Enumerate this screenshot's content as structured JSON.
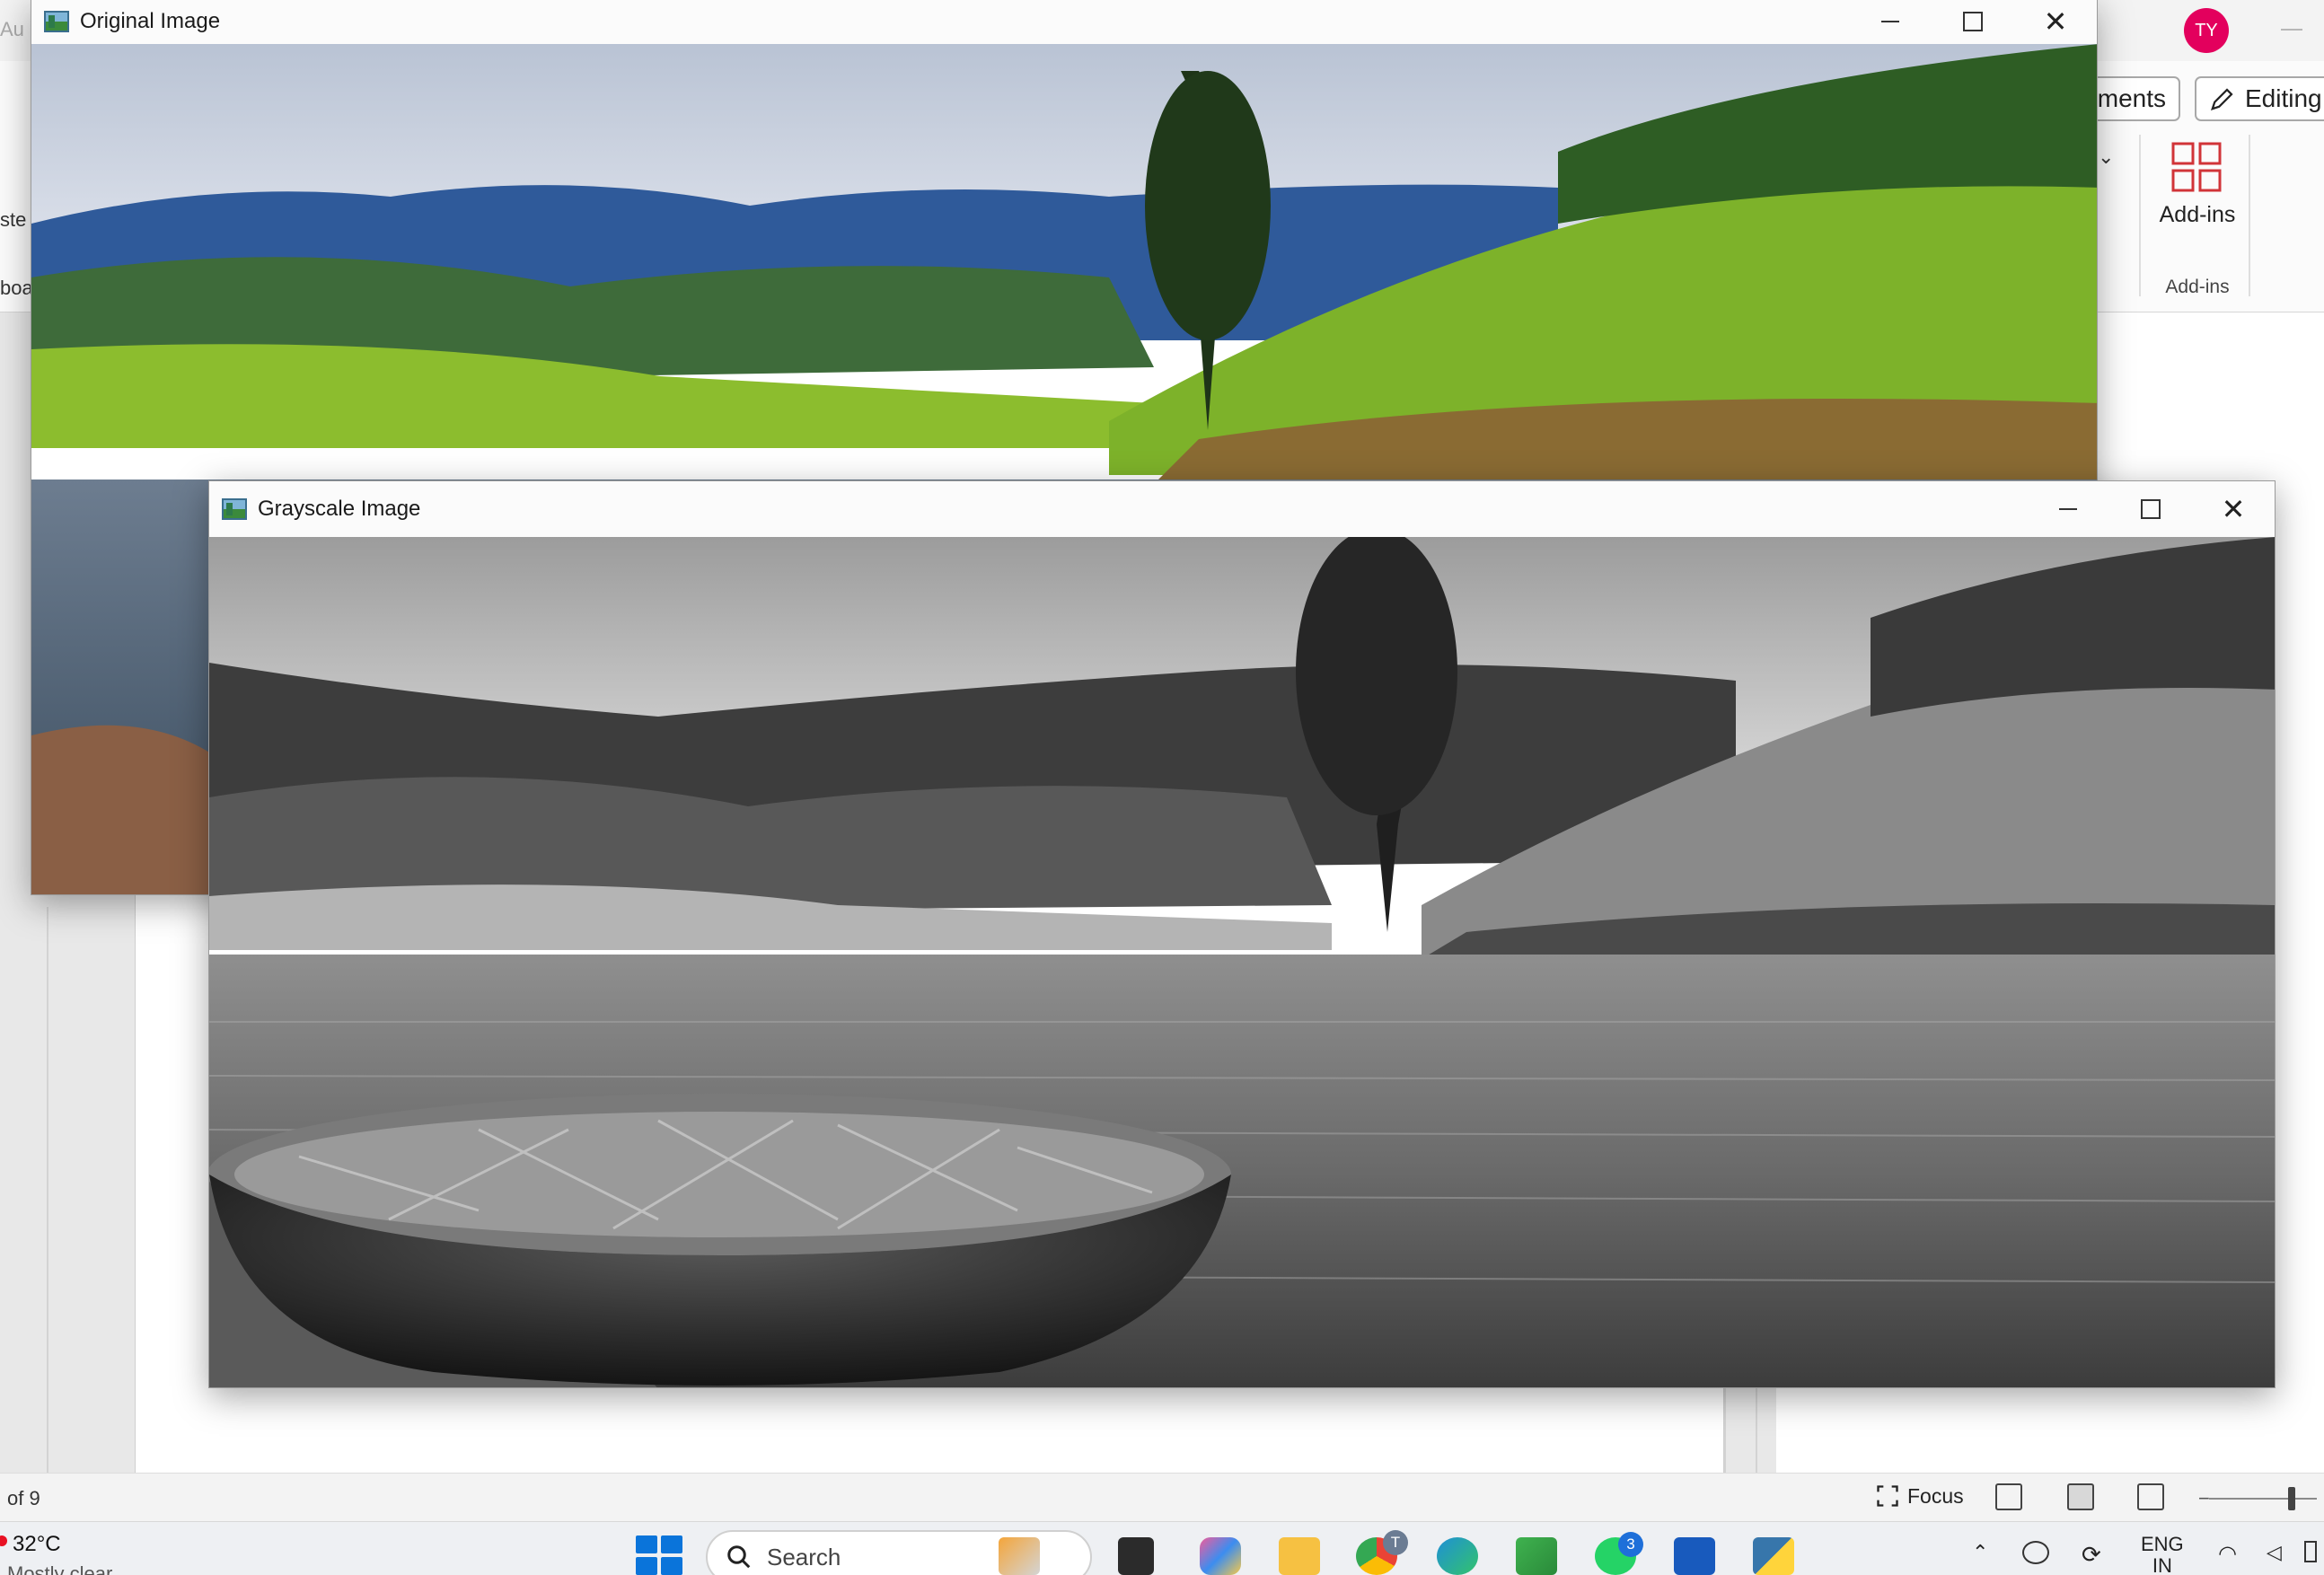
{
  "word": {
    "avatar_initials": "TY",
    "comments_label": "mments",
    "editing_label": "Editing",
    "addins_button_label": "Add-ins",
    "addins_group_label": "Add-ins",
    "left_fragments": [
      "Au",
      "ste",
      "boa"
    ],
    "status": {
      "page_count": "of 9",
      "focus_label": "Focus"
    }
  },
  "windows": {
    "original": {
      "title": "Original Image"
    },
    "grayscale": {
      "title": "Grayscale Image"
    }
  },
  "taskbar": {
    "weather_temp": "32°C",
    "weather_desc": "Mostly clear",
    "search_placeholder": "Search",
    "chrome_badge": "T",
    "whatsapp_badge": "3",
    "language_line1": "ENG",
    "language_line2": "IN",
    "icons": [
      "start-icon",
      "search-icon",
      "widgets-icon",
      "task-view-icon",
      "copilot-icon",
      "file-explorer-icon",
      "chrome-icon",
      "edge-icon",
      "store-icon",
      "whatsapp-icon",
      "word-icon",
      "python-icon"
    ]
  },
  "colors": {
    "accent": "#0a74da",
    "avatar": "#e3005d",
    "close_red": "#e81123"
  }
}
